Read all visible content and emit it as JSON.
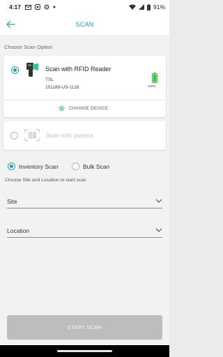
{
  "status_bar": {
    "time": "4:17",
    "battery_text": "91%"
  },
  "app_bar": {
    "title": "SCAN"
  },
  "section": {
    "choose_label": "Choose Scan Option"
  },
  "rfid_option": {
    "name": "Scan with RFID Reader",
    "brand": "TSL",
    "serial": "101189-US-1128",
    "battery_percent": "100%",
    "battery_level": 1.0,
    "change_device_label": "CHANGE DEVICE",
    "selected": true
  },
  "camera_option": {
    "label": "Scan with camera",
    "selected": false
  },
  "scan_types": {
    "inventory_label": "Inventory Scan",
    "bulk_label": "Bulk Scan",
    "selected": "inventory"
  },
  "hint": "Choose Site and Location to start scan",
  "site_select": {
    "label": "Site"
  },
  "location_select": {
    "label": "Location"
  },
  "start_button": {
    "label": "START SCAN",
    "enabled": false
  },
  "colors": {
    "accent": "#1aa5a8",
    "battery_green": "#3cc44a",
    "disabled_button": "#bdbdbd"
  }
}
